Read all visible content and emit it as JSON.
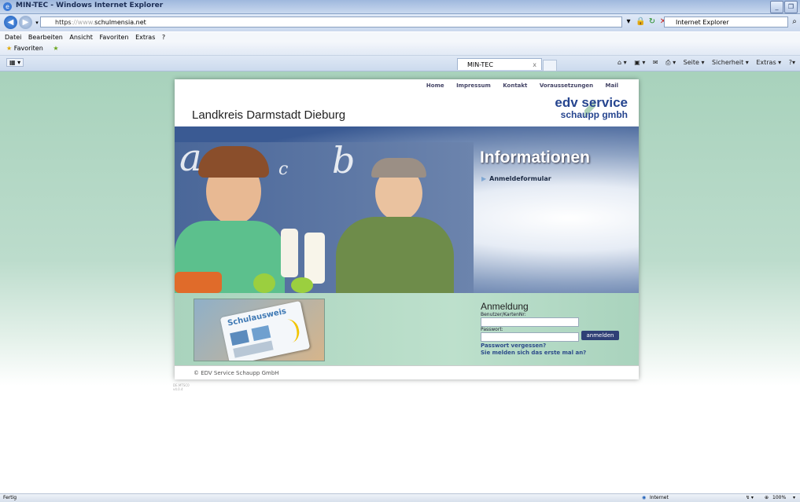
{
  "window": {
    "title": "MIN-TEC - Windows Internet Explorer"
  },
  "address_bar": {
    "protocol": "https",
    "host_hidden": "://www.",
    "domain": "schulmensia.net",
    "search_placeholder": "Internet Explorer"
  },
  "menu": [
    "Datei",
    "Bearbeiten",
    "Ansicht",
    "Favoriten",
    "Extras",
    "?"
  ],
  "favorites": {
    "label": "Favoriten"
  },
  "tab": {
    "title": "MIN-TEC",
    "close": "x"
  },
  "commands": [
    "Seite ▾",
    "Sicherheit ▾",
    "Extras ▾"
  ],
  "site": {
    "nav": [
      "Home",
      "Impressum",
      "Kontakt",
      "Voraussetzungen",
      "Mail"
    ],
    "district": "Landkreis Darmstadt Dieburg",
    "brand_line1": "edv service",
    "brand_line2": "schaupp gmbh",
    "hero_title": "Informationen",
    "hero_link": "Anmeldeformular",
    "letters": [
      "a",
      "c",
      "b"
    ],
    "card_title": "Schulausweis",
    "login": {
      "heading": "Anmeldung",
      "user_label": "Benutzer/KartenNr:",
      "password_label": "Passwort:",
      "button": "anmelden",
      "forgot": "Passwort vergessen?",
      "first_time": "Sie melden sich das erste mal an?"
    },
    "footer": "© EDV Service Schaupp GmbH"
  },
  "tiny_version": [
    "DE.MTSC0",
    "v4.0.4"
  ],
  "status": {
    "left": "Fertig",
    "zone": "Internet",
    "zoom": "100%"
  }
}
